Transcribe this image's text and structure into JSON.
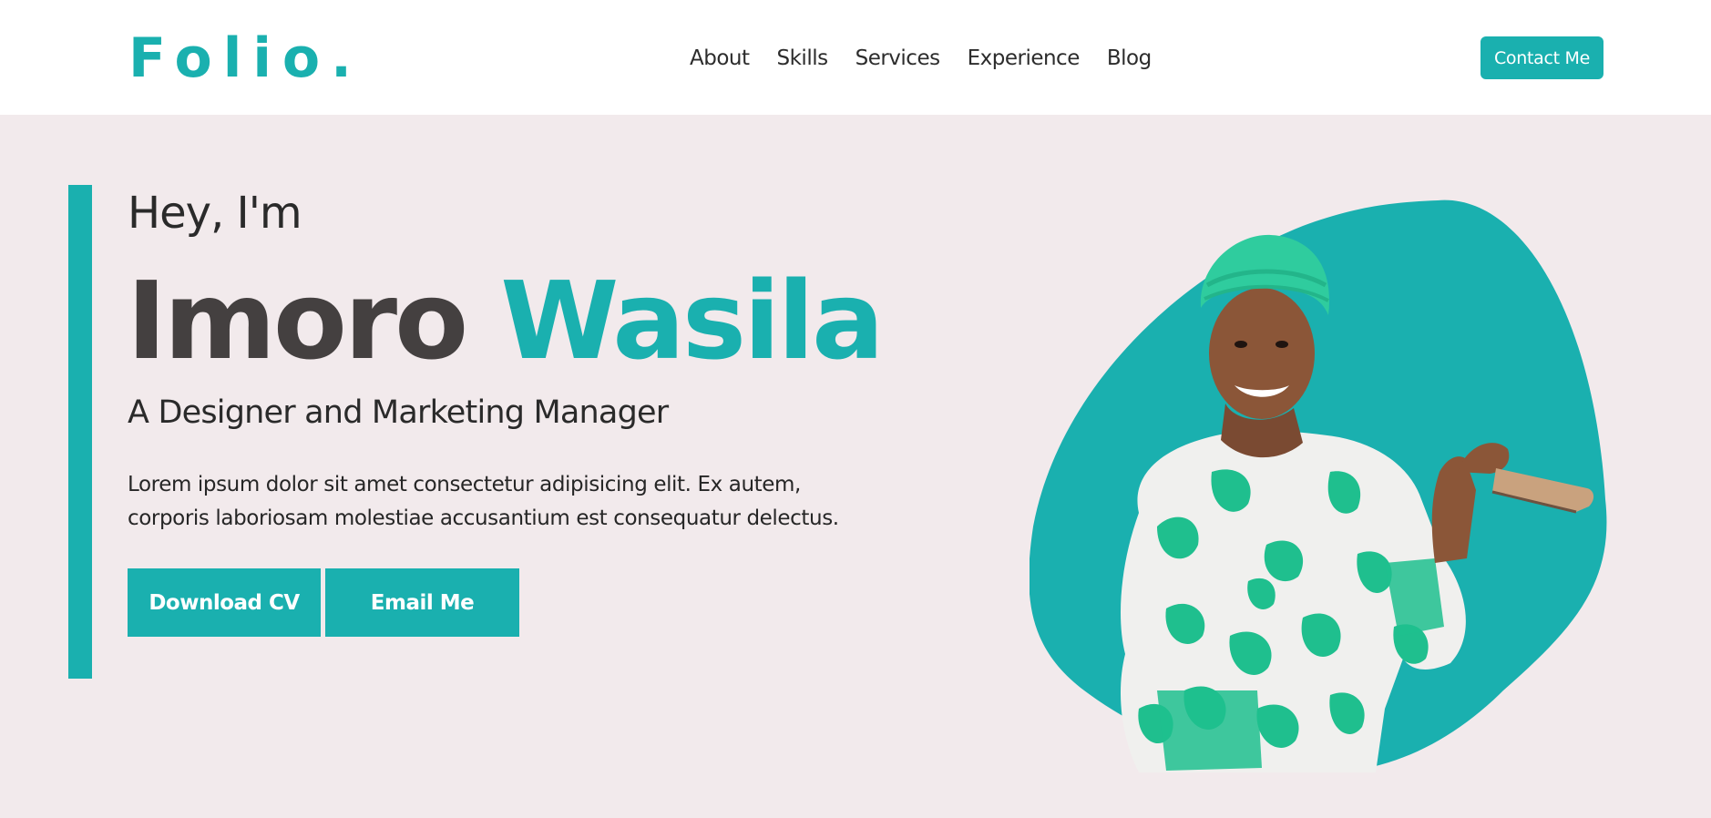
{
  "header": {
    "logo": "Folio.",
    "nav": [
      {
        "label": "About"
      },
      {
        "label": "Skills"
      },
      {
        "label": "Services"
      },
      {
        "label": "Experience"
      },
      {
        "label": "Blog"
      }
    ],
    "contact_label": "Contact Me"
  },
  "hero": {
    "greeting": "Hey, I'm",
    "first_name": "Imoro",
    "last_name": "Wasila",
    "role": "A Designer and Marketing Manager",
    "bio": "Lorem ipsum dolor sit amet consectetur adipisicing elit. Ex autem, corporis laboriosam molestiae accusantium est consequatur delectus.",
    "download_label": "Download CV",
    "email_label": "Email Me"
  },
  "colors": {
    "accent": "#1ab0af",
    "background": "#f2eaec",
    "header_bg": "#ffffff",
    "name_dark": "#444040",
    "outfit_green": "#1fbf8e"
  },
  "icons": {
    "portrait": "person-portrait-image"
  }
}
